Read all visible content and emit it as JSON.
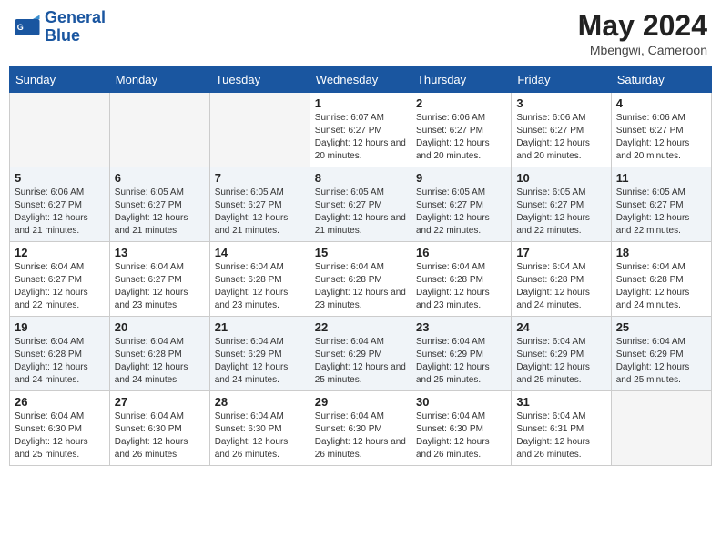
{
  "header": {
    "logo_line1": "General",
    "logo_line2": "Blue",
    "month_year": "May 2024",
    "location": "Mbengwi, Cameroon"
  },
  "weekdays": [
    "Sunday",
    "Monday",
    "Tuesday",
    "Wednesday",
    "Thursday",
    "Friday",
    "Saturday"
  ],
  "weeks": [
    [
      {
        "day": "",
        "info": ""
      },
      {
        "day": "",
        "info": ""
      },
      {
        "day": "",
        "info": ""
      },
      {
        "day": "1",
        "info": "Sunrise: 6:07 AM\nSunset: 6:27 PM\nDaylight: 12 hours\nand 20 minutes."
      },
      {
        "day": "2",
        "info": "Sunrise: 6:06 AM\nSunset: 6:27 PM\nDaylight: 12 hours\nand 20 minutes."
      },
      {
        "day": "3",
        "info": "Sunrise: 6:06 AM\nSunset: 6:27 PM\nDaylight: 12 hours\nand 20 minutes."
      },
      {
        "day": "4",
        "info": "Sunrise: 6:06 AM\nSunset: 6:27 PM\nDaylight: 12 hours\nand 20 minutes."
      }
    ],
    [
      {
        "day": "5",
        "info": "Sunrise: 6:06 AM\nSunset: 6:27 PM\nDaylight: 12 hours\nand 21 minutes."
      },
      {
        "day": "6",
        "info": "Sunrise: 6:05 AM\nSunset: 6:27 PM\nDaylight: 12 hours\nand 21 minutes."
      },
      {
        "day": "7",
        "info": "Sunrise: 6:05 AM\nSunset: 6:27 PM\nDaylight: 12 hours\nand 21 minutes."
      },
      {
        "day": "8",
        "info": "Sunrise: 6:05 AM\nSunset: 6:27 PM\nDaylight: 12 hours\nand 21 minutes."
      },
      {
        "day": "9",
        "info": "Sunrise: 6:05 AM\nSunset: 6:27 PM\nDaylight: 12 hours\nand 22 minutes."
      },
      {
        "day": "10",
        "info": "Sunrise: 6:05 AM\nSunset: 6:27 PM\nDaylight: 12 hours\nand 22 minutes."
      },
      {
        "day": "11",
        "info": "Sunrise: 6:05 AM\nSunset: 6:27 PM\nDaylight: 12 hours\nand 22 minutes."
      }
    ],
    [
      {
        "day": "12",
        "info": "Sunrise: 6:04 AM\nSunset: 6:27 PM\nDaylight: 12 hours\nand 22 minutes."
      },
      {
        "day": "13",
        "info": "Sunrise: 6:04 AM\nSunset: 6:27 PM\nDaylight: 12 hours\nand 23 minutes."
      },
      {
        "day": "14",
        "info": "Sunrise: 6:04 AM\nSunset: 6:28 PM\nDaylight: 12 hours\nand 23 minutes."
      },
      {
        "day": "15",
        "info": "Sunrise: 6:04 AM\nSunset: 6:28 PM\nDaylight: 12 hours\nand 23 minutes."
      },
      {
        "day": "16",
        "info": "Sunrise: 6:04 AM\nSunset: 6:28 PM\nDaylight: 12 hours\nand 23 minutes."
      },
      {
        "day": "17",
        "info": "Sunrise: 6:04 AM\nSunset: 6:28 PM\nDaylight: 12 hours\nand 24 minutes."
      },
      {
        "day": "18",
        "info": "Sunrise: 6:04 AM\nSunset: 6:28 PM\nDaylight: 12 hours\nand 24 minutes."
      }
    ],
    [
      {
        "day": "19",
        "info": "Sunrise: 6:04 AM\nSunset: 6:28 PM\nDaylight: 12 hours\nand 24 minutes."
      },
      {
        "day": "20",
        "info": "Sunrise: 6:04 AM\nSunset: 6:28 PM\nDaylight: 12 hours\nand 24 minutes."
      },
      {
        "day": "21",
        "info": "Sunrise: 6:04 AM\nSunset: 6:29 PM\nDaylight: 12 hours\nand 24 minutes."
      },
      {
        "day": "22",
        "info": "Sunrise: 6:04 AM\nSunset: 6:29 PM\nDaylight: 12 hours\nand 25 minutes."
      },
      {
        "day": "23",
        "info": "Sunrise: 6:04 AM\nSunset: 6:29 PM\nDaylight: 12 hours\nand 25 minutes."
      },
      {
        "day": "24",
        "info": "Sunrise: 6:04 AM\nSunset: 6:29 PM\nDaylight: 12 hours\nand 25 minutes."
      },
      {
        "day": "25",
        "info": "Sunrise: 6:04 AM\nSunset: 6:29 PM\nDaylight: 12 hours\nand 25 minutes."
      }
    ],
    [
      {
        "day": "26",
        "info": "Sunrise: 6:04 AM\nSunset: 6:30 PM\nDaylight: 12 hours\nand 25 minutes."
      },
      {
        "day": "27",
        "info": "Sunrise: 6:04 AM\nSunset: 6:30 PM\nDaylight: 12 hours\nand 26 minutes."
      },
      {
        "day": "28",
        "info": "Sunrise: 6:04 AM\nSunset: 6:30 PM\nDaylight: 12 hours\nand 26 minutes."
      },
      {
        "day": "29",
        "info": "Sunrise: 6:04 AM\nSunset: 6:30 PM\nDaylight: 12 hours\nand 26 minutes."
      },
      {
        "day": "30",
        "info": "Sunrise: 6:04 AM\nSunset: 6:30 PM\nDaylight: 12 hours\nand 26 minutes."
      },
      {
        "day": "31",
        "info": "Sunrise: 6:04 AM\nSunset: 6:31 PM\nDaylight: 12 hours\nand 26 minutes."
      },
      {
        "day": "",
        "info": ""
      }
    ]
  ]
}
